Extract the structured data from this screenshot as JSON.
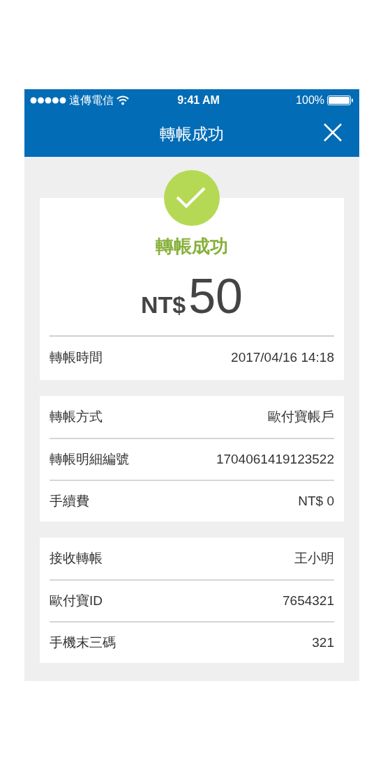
{
  "status_bar": {
    "carrier": "遠傳電信",
    "time": "9:41 AM",
    "battery": "100%"
  },
  "nav": {
    "title": "轉帳成功"
  },
  "summary": {
    "status": "轉帳成功",
    "currency": "NT$",
    "amount": "50",
    "rows": [
      {
        "label": "轉帳時間",
        "value": "2017/04/16 14:18"
      }
    ]
  },
  "sections": [
    {
      "rows": [
        {
          "label": "轉帳方式",
          "value": "歐付寶帳戶"
        },
        {
          "label": "轉帳明細編號",
          "value": "1704061419123522"
        },
        {
          "label": "手續費",
          "value": "NT$ 0"
        }
      ]
    },
    {
      "rows": [
        {
          "label": "接收轉帳",
          "value": "王小明"
        },
        {
          "label": "歐付寶ID",
          "value": "7654321"
        },
        {
          "label": "手機末三碼",
          "value": "321"
        }
      ]
    }
  ]
}
